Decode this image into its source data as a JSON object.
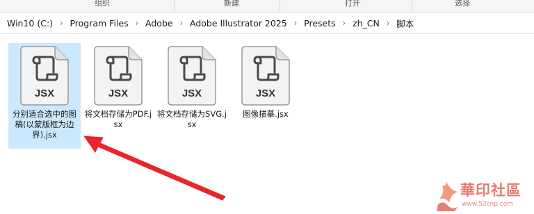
{
  "ribbon": {
    "groups": [
      "组织",
      "新建",
      "打开",
      "选择"
    ]
  },
  "breadcrumb": {
    "items": [
      "Win10 (C:)",
      "Program Files",
      "Adobe",
      "Adobe Illustrator 2025",
      "Presets",
      "zh_CN",
      "脚本"
    ],
    "separator": "›"
  },
  "files": [
    {
      "name": "分别适合选中的图稿(以蒙版框为边界).jsx",
      "icon_label": "JSX",
      "selected": true
    },
    {
      "name": "将文档存储为PDF.jsx",
      "icon_label": "JSX",
      "selected": false
    },
    {
      "name": "将文档存储为SVG.jsx",
      "icon_label": "JSX",
      "selected": false
    },
    {
      "name": "图像描摹.jsx",
      "icon_label": "JSX",
      "selected": false
    }
  ],
  "icons": {
    "file_icon": "script-scroll-icon"
  },
  "colors": {
    "selection": "#cce8ff",
    "annotation_arrow": "#e8262a",
    "watermark": "#e0503d"
  },
  "watermark": {
    "title": "華印社區",
    "url": "www.52cnp.com"
  }
}
